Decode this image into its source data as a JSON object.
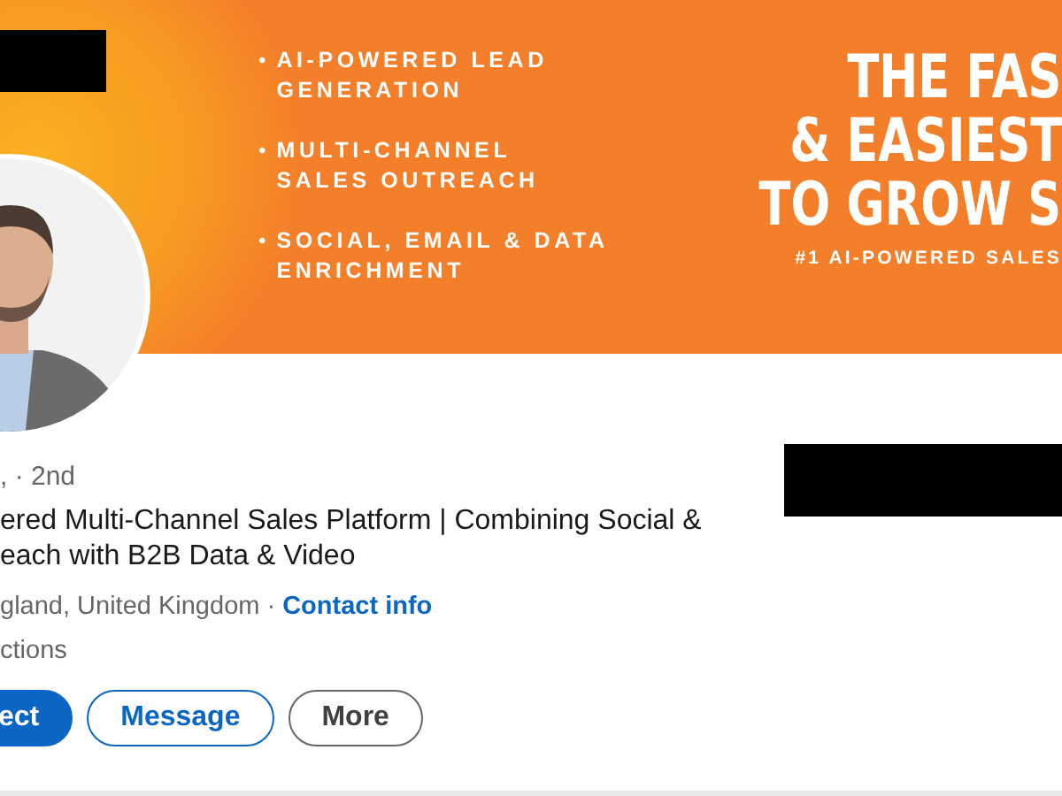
{
  "banner": {
    "bullets": [
      "AI-POWERED LEAD GENERATION",
      "MULTI-CHANNEL SALES OUTREACH",
      "SOCIAL, EMAIL & DATA ENRICHMENT"
    ],
    "bullet_mark": "•",
    "headline_lines": [
      "THE FAS",
      "& EASIEST",
      "TO GROW S"
    ],
    "tagline": "#1 AI-POWERED SALES"
  },
  "profile": {
    "degree": ", · 2nd",
    "headline_lines": [
      "ered Multi-Channel Sales Platform | Combining Social &",
      "each with B2B Data & Video"
    ],
    "location": "gland, United Kingdom",
    "separator": "·",
    "contact_link": "Contact info",
    "connections": "ctions",
    "buttons": [
      {
        "label": "ect",
        "kind": "primary"
      },
      {
        "label": "Message",
        "kind": "outline"
      },
      {
        "label": "More",
        "kind": "neutral"
      }
    ]
  }
}
